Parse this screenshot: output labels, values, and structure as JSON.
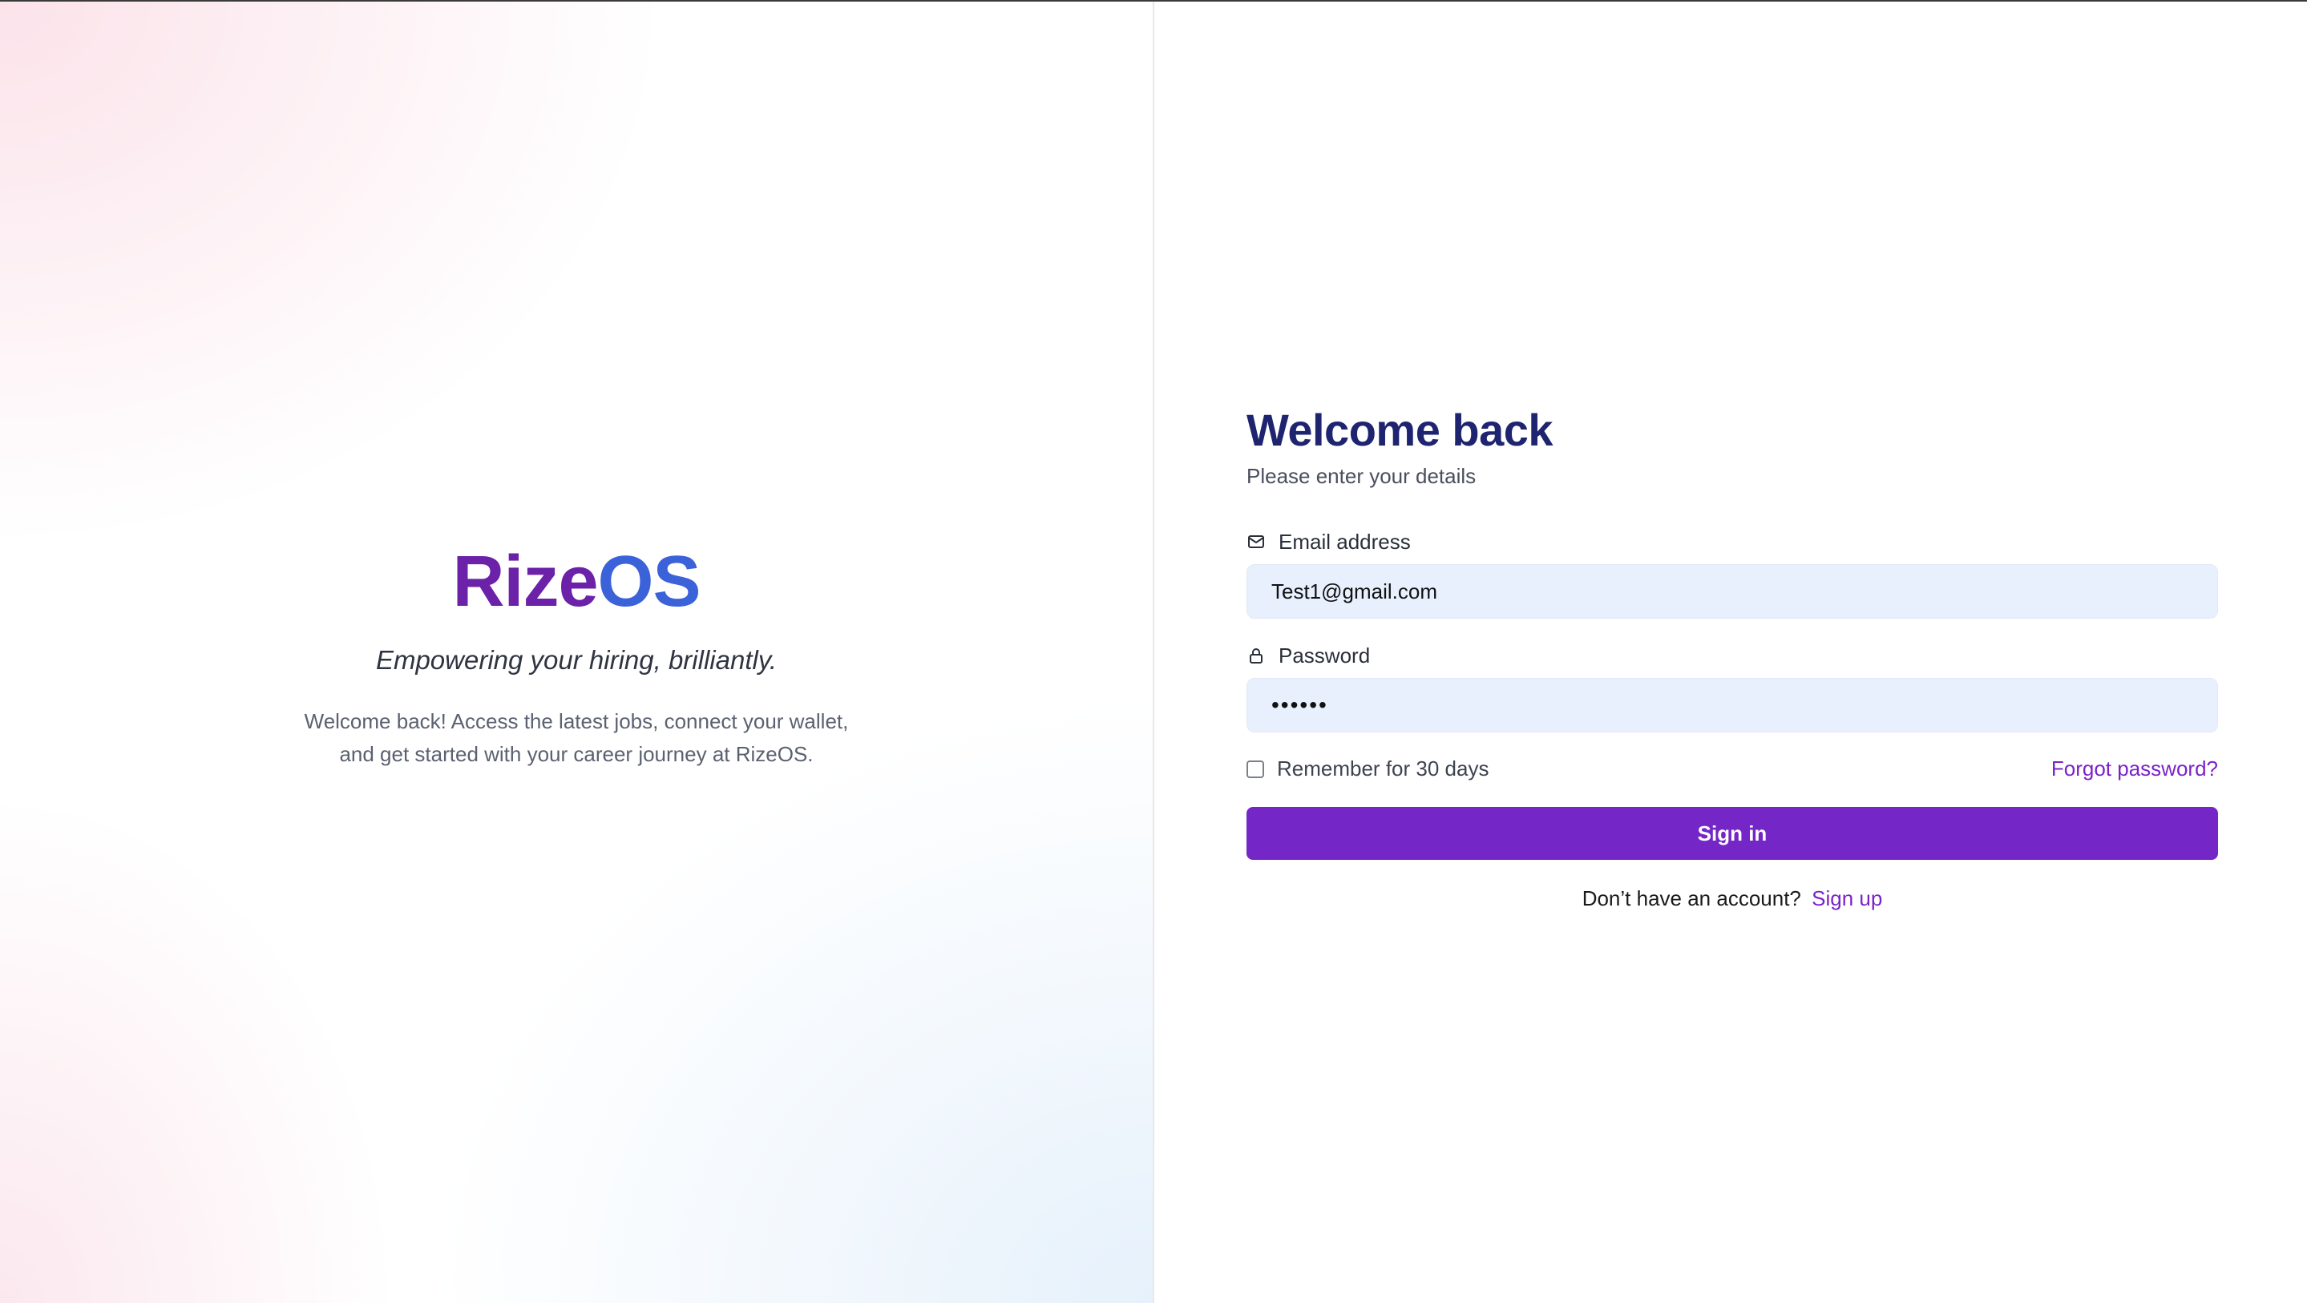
{
  "brand": {
    "name_part1": "Rize",
    "name_part2": "OS",
    "tagline": "Empowering your hiring, brilliantly.",
    "description_line1": "Welcome back! Access the latest jobs, connect your wallet,",
    "description_line2": "and get started with your career journey at RizeOS."
  },
  "form": {
    "title": "Welcome back",
    "subtitle": "Please enter your details",
    "email_label": "Email address",
    "email_value": "Test1@gmail.com",
    "password_label": "Password",
    "password_value": "••••••",
    "remember_label": "Remember for 30 days",
    "remember_checked": false,
    "forgot_label": "Forgot password?",
    "signin_label": "Sign in",
    "no_account_text": "Don’t have an account?",
    "signup_label": "Sign up"
  },
  "icons": {
    "email": "mail-icon",
    "password": "lock-icon"
  },
  "colors": {
    "brand_purple": "#6b21a8",
    "brand_blue": "#3b62d9",
    "title_navy": "#1e2470",
    "primary_button": "#7526c6",
    "link_purple": "#7a23c9",
    "input_bg": "#e8f0fe"
  }
}
